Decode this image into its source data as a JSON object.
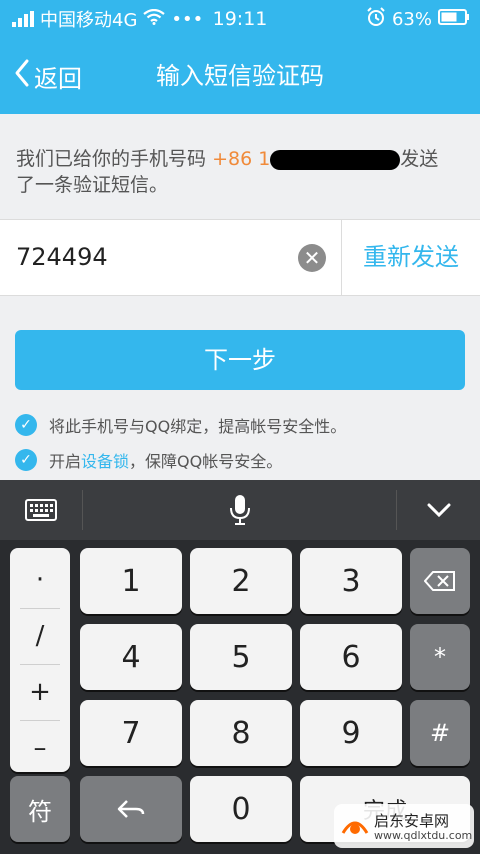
{
  "status_bar": {
    "carrier": "中国移动4G",
    "dots": "•••",
    "time": "19:11",
    "battery": "63%"
  },
  "nav": {
    "back_label": "返回",
    "title": "输入短信验证码"
  },
  "info": {
    "prefix": "我们已给你的手机号码",
    "phone_prefix": "+86 1",
    "suffix": "发送",
    "line2": "了一条验证短信。"
  },
  "code_input": {
    "value": "724494"
  },
  "resend_label": "重新发送",
  "next_label": "下一步",
  "options": [
    {
      "text": "将此手机号与QQ绑定，提高帐号安全性。"
    },
    {
      "text_before": "开启",
      "link": "设备锁",
      "text_after": "，保障QQ帐号安全。"
    }
  ],
  "keyboard": {
    "symbols": [
      "·",
      "/",
      "+",
      "–"
    ],
    "keys": [
      "1",
      "2",
      "3",
      "4",
      "5",
      "6",
      "7",
      "8",
      "9"
    ],
    "right": [
      "*",
      "#"
    ],
    "bottom": {
      "fu": "符",
      "zero": "0",
      "done": "完成"
    }
  },
  "watermark": {
    "name": "启东安卓网",
    "url": "www.qdlxtdu.com"
  }
}
